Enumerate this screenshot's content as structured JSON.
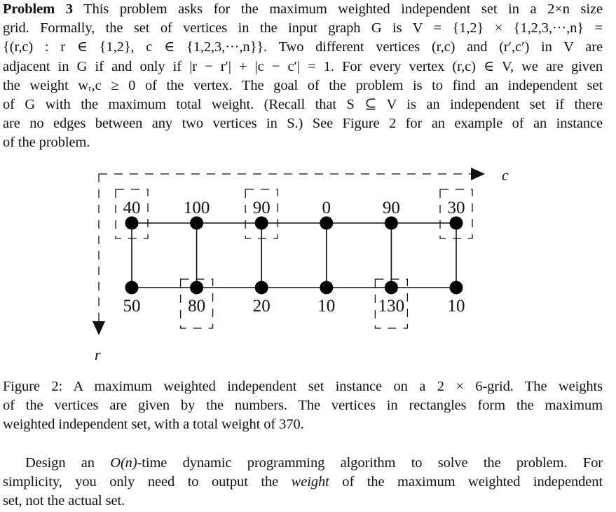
{
  "problem": {
    "heading": "Problem 3",
    "lines": [
      " This problem asks for the maximum weighted independent set in a 2×n size",
      "grid. Formally, the set of vertices in the input graph G is V = {1,2} × {1,2,3,···,n} =",
      "{(r,c) : r ∈ {1,2}, c ∈ {1,2,3,···,n}}. Two different vertices (r,c) and (r′,c′) in V are",
      "adjacent in G if and only if |r − r′| + |c − c′| = 1. For every vertex (r,c) ∈ V, we are given",
      "the weight wᵣ,c ≥ 0 of the vertex. The goal of the problem is to find an independent set",
      "of G with the maximum total weight. (Recall that S ⊆ V is an independent set if there",
      "are no edges between any two vertices in S.) See Figure 2 for an example of an instance",
      "of the problem."
    ]
  },
  "figure": {
    "axis_col_label": "c",
    "axis_row_label": "r",
    "rows": 2,
    "cols": 6,
    "top_row_weights": [
      "40",
      "100",
      "90",
      "0",
      "90",
      "30"
    ],
    "bottom_row_weights": [
      "50",
      "80",
      "20",
      "10",
      "130",
      "10"
    ],
    "selected_vertices": [
      {
        "row": 1,
        "col": 1
      },
      {
        "row": 1,
        "col": 3
      },
      {
        "row": 1,
        "col": 6
      },
      {
        "row": 2,
        "col": 2
      },
      {
        "row": 2,
        "col": 5
      }
    ]
  },
  "caption": {
    "lines": [
      "Figure 2: A maximum weighted independent set instance on a 2 × 6-grid. The weights",
      "of the vertices are given by the numbers. The vertices in rectangles form the maximum",
      "weighted independent set, with a total weight of 370."
    ]
  },
  "task": {
    "line1_pre": "Design an ",
    "line1_math": "O(n)",
    "line1_post": "-time dynamic programming algorithm to solve the problem. For",
    "line2_pre": "simplicity, you only need to output the ",
    "line2_em": "weight",
    "line2_post": " of the maximum weighted independent",
    "line3": "set, not the actual set."
  }
}
